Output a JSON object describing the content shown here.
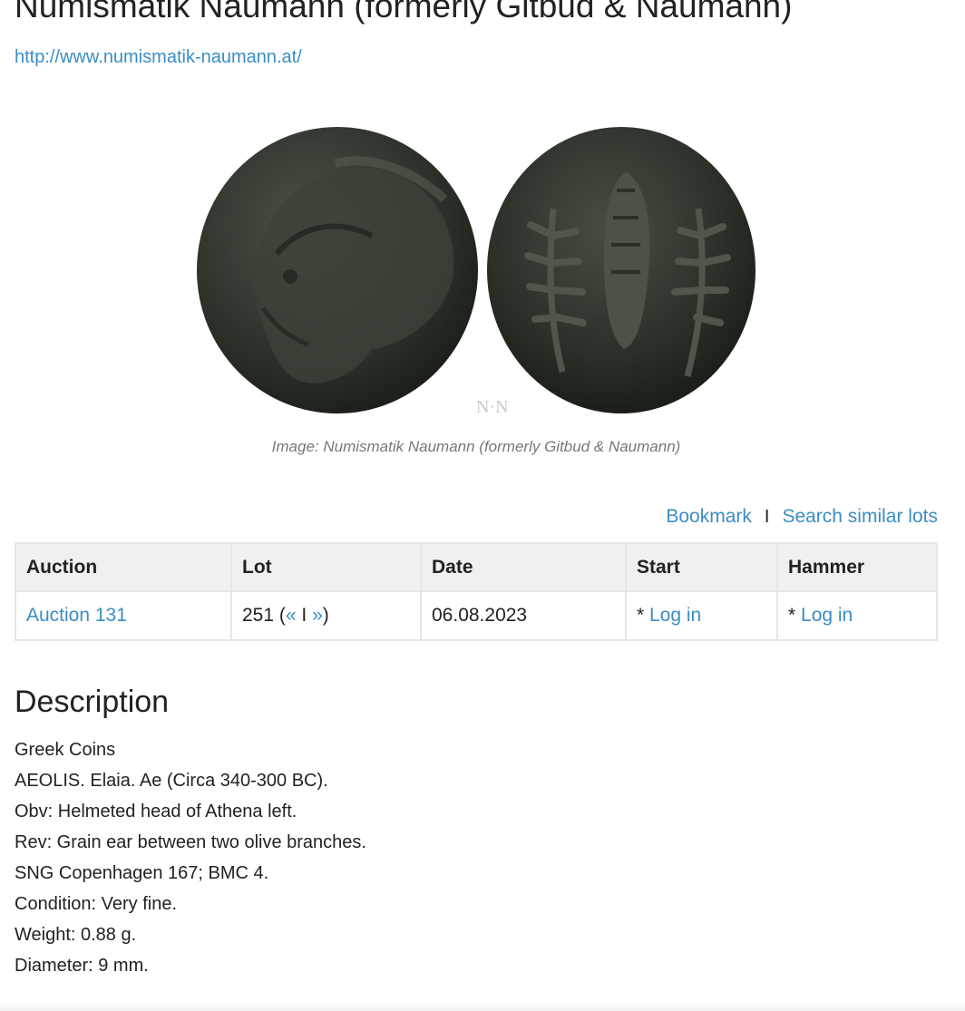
{
  "header": {
    "title": "Numismatik Naumann (formerly Gitbud & Naumann)",
    "link": "http://www.numismatik-naumann.at/"
  },
  "image": {
    "watermark": "N·N",
    "caption": "Image: Numismatik Naumann (formerly Gitbud & Naumann)"
  },
  "actions": {
    "bookmark": "Bookmark",
    "separator": "I",
    "search_similar": "Search similar lots"
  },
  "lot_table": {
    "headers": [
      "Auction",
      "Lot",
      "Date",
      "Start",
      "Hammer"
    ],
    "row": {
      "auction": "Auction 131",
      "lot_number": "251",
      "lot_open": "(",
      "prev": "«",
      "nav_sep": "I",
      "next": "»",
      "lot_close": ")",
      "date": "06.08.2023",
      "start_prefix": "* ",
      "start_link": "Log in",
      "hammer_prefix": "* ",
      "hammer_link": "Log in"
    }
  },
  "description": {
    "heading": "Description",
    "lines": [
      "Greek Coins",
      "AEOLIS. Elaia. Ae (Circa 340-300 BC).",
      "Obv: Helmeted head of Athena left.",
      "Rev: Grain ear between two olive branches.",
      "SNG Copenhagen 167; BMC 4.",
      "Condition: Very fine.",
      "Weight: 0.88 g.",
      "Diameter: 9 mm."
    ]
  },
  "colors": {
    "link": "#3a8dc4",
    "text": "#222222",
    "table_header_bg": "#f0f0f0",
    "coin_patina": "#2f352d"
  }
}
